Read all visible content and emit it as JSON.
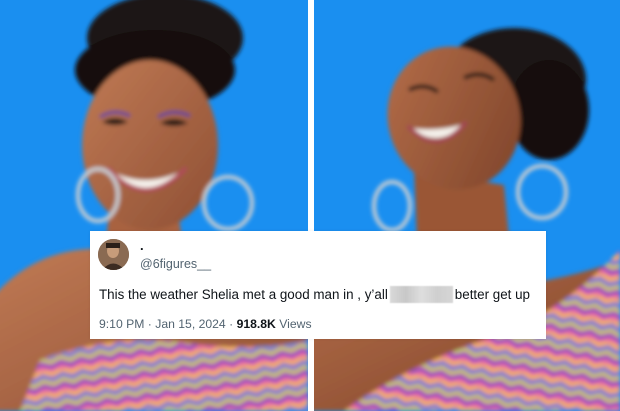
{
  "tweet": {
    "display_name": ".",
    "handle": "@6figures__",
    "text_before": "This the weather Shelia met a good man in , y’all",
    "text_after": "better get up",
    "time": "9:10 PM",
    "separator": "·",
    "date": "Jan 15, 2024",
    "views_count": "918.8K",
    "views_label": "Views"
  },
  "colors": {
    "background_blue": "#1a8ff0",
    "text_primary": "#0f1419",
    "text_secondary": "#536471"
  }
}
